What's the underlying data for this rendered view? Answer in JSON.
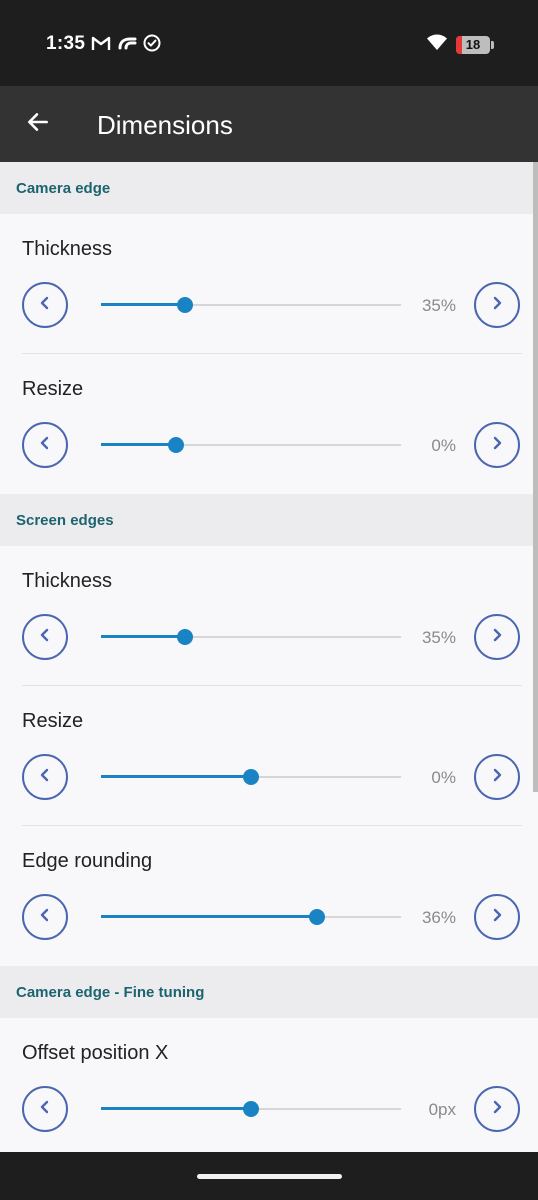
{
  "status": {
    "time": "1:35",
    "battery_level": "18",
    "icons_left": [
      "gmail-icon",
      "app-icon",
      "check-circle-icon"
    ],
    "icons_right": [
      "wifi-icon",
      "battery-icon"
    ]
  },
  "app_bar": {
    "title": "Dimensions"
  },
  "colors": {
    "accent": "#1a83c4",
    "button_border": "#4a66b0",
    "section_text": "#1c6470"
  },
  "sections": [
    {
      "title": "Camera edge",
      "items": [
        {
          "label": "Thickness",
          "value": "35%",
          "position": 0.28
        },
        {
          "label": "Resize",
          "value": "0%",
          "position": 0.25
        }
      ]
    },
    {
      "title": "Screen edges",
      "items": [
        {
          "label": "Thickness",
          "value": "35%",
          "position": 0.28
        },
        {
          "label": "Resize",
          "value": "0%",
          "position": 0.5
        },
        {
          "label": "Edge rounding",
          "value": "36%",
          "position": 0.72
        }
      ]
    },
    {
      "title": "Camera edge - Fine tuning",
      "items": [
        {
          "label": "Offset position X",
          "value": "0px",
          "position": 0.5
        }
      ]
    }
  ]
}
